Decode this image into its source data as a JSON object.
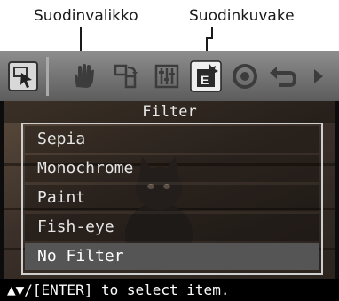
{
  "callouts": {
    "filter_menu": "Suodinvalikko",
    "filter_icon": "Suodinkuvake"
  },
  "toolbar": {
    "icons": [
      "select-arrow-icon",
      "hand-icon",
      "rotate-icon",
      "adjust-icon",
      "filter-icon",
      "red-eye-icon",
      "undo-icon",
      "next-arrow-icon"
    ],
    "selected": "filter-icon"
  },
  "menu": {
    "title": "Filter",
    "items": [
      "Sepia",
      "Monochrome",
      "Paint",
      "Fish-eye",
      "No Filter"
    ],
    "selected_index": 4
  },
  "status": "▲▼/[ENTER] to select item.",
  "colors": {
    "toolbar": "#777777",
    "highlight": "#555555",
    "screen": "#0c0c0c"
  }
}
